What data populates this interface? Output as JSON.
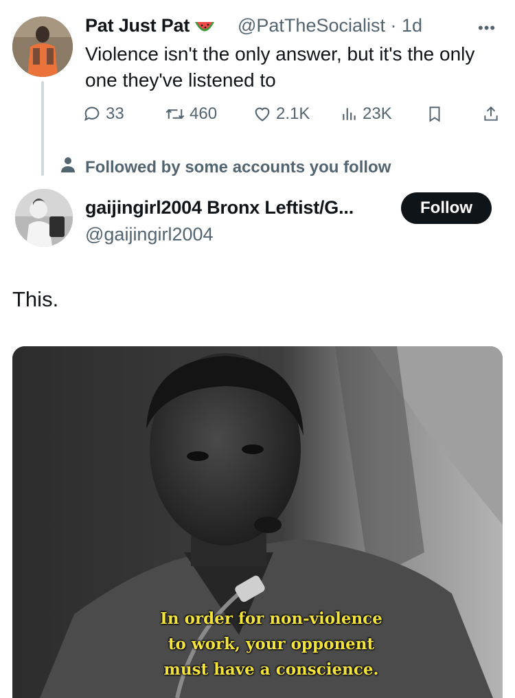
{
  "parent_tweet": {
    "display_name": "Pat Just Pat",
    "handle_and_time": "@PatTheSocialist · 1d",
    "more_icon": "ellipsis-icon",
    "text": "Violence isn't the only answer, but it's the only one they've listened to",
    "replies": "33",
    "reposts": "460",
    "likes": "2.1K",
    "views": "23K"
  },
  "followed_by": "Followed by some accounts you follow",
  "main_tweet": {
    "display_name": "gaijingirl2004 Bronx Leftist/G...",
    "handle": "@gaijingirl2004",
    "follow_label": "Follow",
    "text": "This.",
    "image_caption_lines": [
      "In order for non-violence",
      "to work, your opponent",
      "must have a conscience."
    ]
  },
  "colors": {
    "secondary_text": "#536471",
    "primary_text": "#0f1419",
    "follow_button_bg": "#0f1419",
    "subtitle_yellow": "#f3e33a"
  }
}
